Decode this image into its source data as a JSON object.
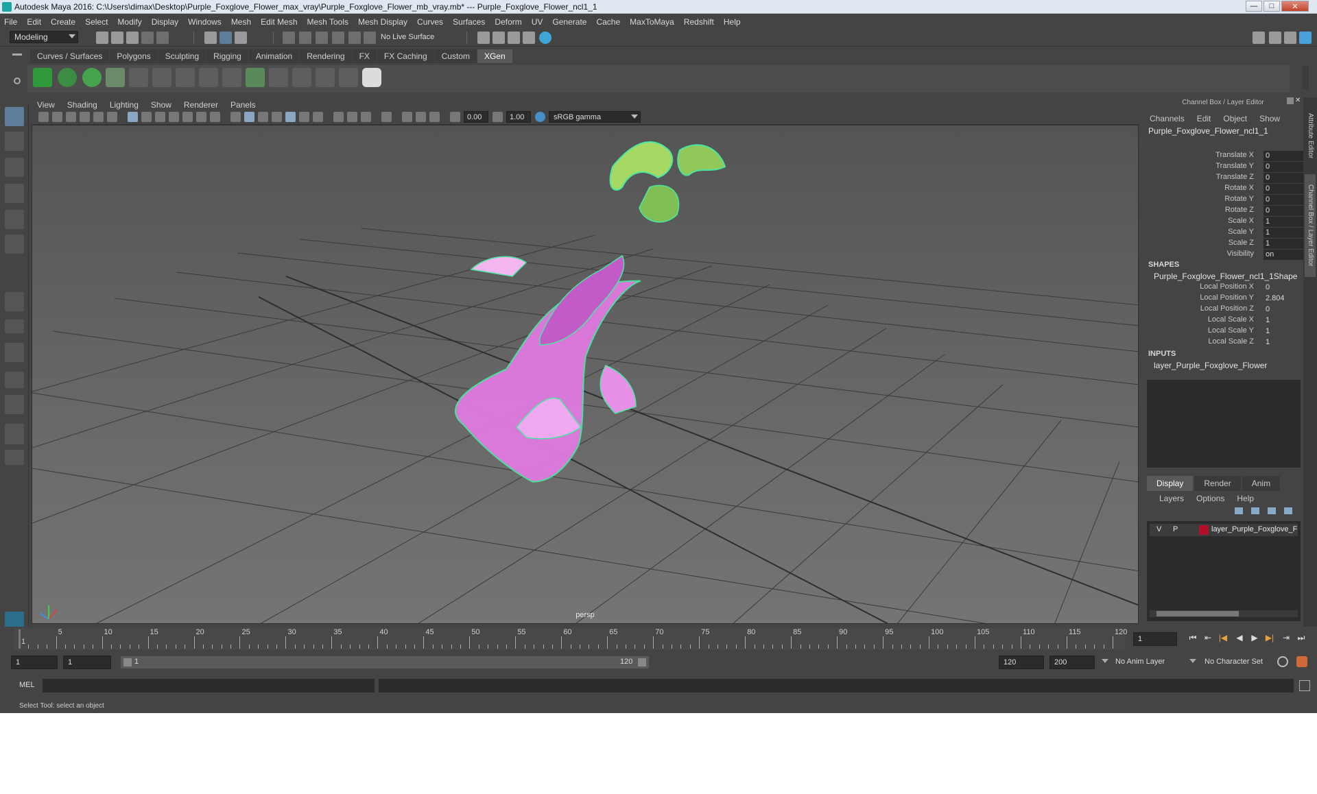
{
  "window": {
    "title": "Autodesk Maya 2016: C:\\Users\\dimax\\Desktop\\Purple_Foxglove_Flower_max_vray\\Purple_Foxglove_Flower_mb_vray.mb*   ---   Purple_Foxglove_Flower_ncl1_1",
    "minimize": "—",
    "maximize": "□",
    "close": "✕"
  },
  "menubar": [
    "File",
    "Edit",
    "Create",
    "Select",
    "Modify",
    "Display",
    "Windows",
    "Mesh",
    "Edit Mesh",
    "Mesh Tools",
    "Mesh Display",
    "Curves",
    "Surfaces",
    "Deform",
    "UV",
    "Generate",
    "Cache",
    "MaxToMaya",
    "Redshift",
    "Help"
  ],
  "statusline": {
    "mode": "Modeling",
    "live_surface": "No Live Surface"
  },
  "shelf": {
    "tabs": [
      {
        "label": "Curves / Surfaces",
        "active": false
      },
      {
        "label": "Polygons",
        "active": false
      },
      {
        "label": "Sculpting",
        "active": false
      },
      {
        "label": "Rigging",
        "active": false
      },
      {
        "label": "Animation",
        "active": false
      },
      {
        "label": "Rendering",
        "active": false
      },
      {
        "label": "FX",
        "active": false
      },
      {
        "label": "FX Caching",
        "active": false
      },
      {
        "label": "Custom",
        "active": false
      },
      {
        "label": "XGen",
        "active": true
      }
    ]
  },
  "panel": {
    "menu": [
      "View",
      "Shading",
      "Lighting",
      "Show",
      "Renderer",
      "Panels"
    ],
    "exposure": "0.00",
    "gamma": "1.00",
    "colorspace": "sRGB gamma",
    "camera_label": "persp"
  },
  "channel_box": {
    "header": "Channel Box / Layer Editor",
    "menu": [
      "Channels",
      "Edit",
      "Object",
      "Show"
    ],
    "object_name": "Purple_Foxglove_Flower_ncl1_1",
    "attributes": [
      {
        "name": "Translate X",
        "value": "0"
      },
      {
        "name": "Translate Y",
        "value": "0"
      },
      {
        "name": "Translate Z",
        "value": "0"
      },
      {
        "name": "Rotate X",
        "value": "0"
      },
      {
        "name": "Rotate Y",
        "value": "0"
      },
      {
        "name": "Rotate Z",
        "value": "0"
      },
      {
        "name": "Scale X",
        "value": "1"
      },
      {
        "name": "Scale Y",
        "value": "1"
      },
      {
        "name": "Scale Z",
        "value": "1"
      },
      {
        "name": "Visibility",
        "value": "on"
      }
    ],
    "shapes_label": "SHAPES",
    "shape_name": "Purple_Foxglove_Flower_ncl1_1Shape",
    "shape_attributes": [
      {
        "name": "Local Position X",
        "value": "0"
      },
      {
        "name": "Local Position Y",
        "value": "2.804"
      },
      {
        "name": "Local Position Z",
        "value": "0"
      },
      {
        "name": "Local Scale X",
        "value": "1"
      },
      {
        "name": "Local Scale Y",
        "value": "1"
      },
      {
        "name": "Local Scale Z",
        "value": "1"
      }
    ],
    "inputs_label": "INPUTS",
    "input_name": "layer_Purple_Foxglove_Flower"
  },
  "layer_editor": {
    "tabs": [
      {
        "label": "Display",
        "active": true
      },
      {
        "label": "Render",
        "active": false
      },
      {
        "label": "Anim",
        "active": false
      }
    ],
    "menu": [
      "Layers",
      "Options",
      "Help"
    ],
    "layer": {
      "v": "V",
      "p": "P",
      "name": "layer_Purple_Foxglove_F",
      "color": "#b0102a"
    }
  },
  "side_tabs": [
    "Attribute Editor",
    "Channel Box / Layer Editor"
  ],
  "timeslider": {
    "ticks": [
      "1",
      "5",
      "10",
      "15",
      "20",
      "25",
      "30",
      "35",
      "40",
      "45",
      "50",
      "55",
      "60",
      "65",
      "70",
      "75",
      "80",
      "85",
      "90",
      "95",
      "100",
      "105",
      "110",
      "115",
      "120"
    ],
    "current_frame": "1"
  },
  "range": {
    "start": "1",
    "anim_start": "1",
    "range_start_label": "1",
    "range_end_label": "120",
    "playback_end": "120",
    "anim_end": "200",
    "anim_layer": "No Anim Layer",
    "character_set": "No Character Set"
  },
  "command": {
    "language": "MEL"
  },
  "helpline": "Select Tool: select an object",
  "colors": {
    "selection_wire": "#49e6a0",
    "flower": "#e07ae0",
    "layer_color": "#b0102a"
  }
}
